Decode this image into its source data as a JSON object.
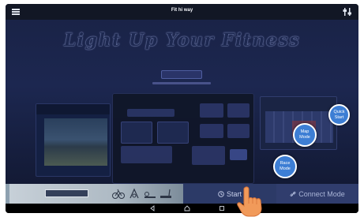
{
  "app": {
    "title": "Fit hi way"
  },
  "headline": "Light Up Your Fitness",
  "modes": [
    {
      "label_line1": "Quick",
      "label_line2": "Start"
    },
    {
      "label_line1": "Map",
      "label_line2": "Mode"
    },
    {
      "label_line1": "Race",
      "label_line2": "Mode"
    }
  ],
  "bottom_bar": {
    "start_label": "Start",
    "connect_label": "Connect Mode"
  },
  "icons": {
    "menu": "hamburger-icon",
    "settings": "settings-sliders-icon",
    "start": "clock-icon",
    "connect": "link-icon",
    "nav_back": "back-triangle-icon",
    "nav_home": "home-icon",
    "nav_recent": "recent-apps-icon",
    "pointer": "pointing-hand-icon"
  },
  "colors": {
    "accent": "#3d7ed4",
    "topbar": "#121725",
    "stage": "#1c2750",
    "start_button": "#2c3a67"
  }
}
